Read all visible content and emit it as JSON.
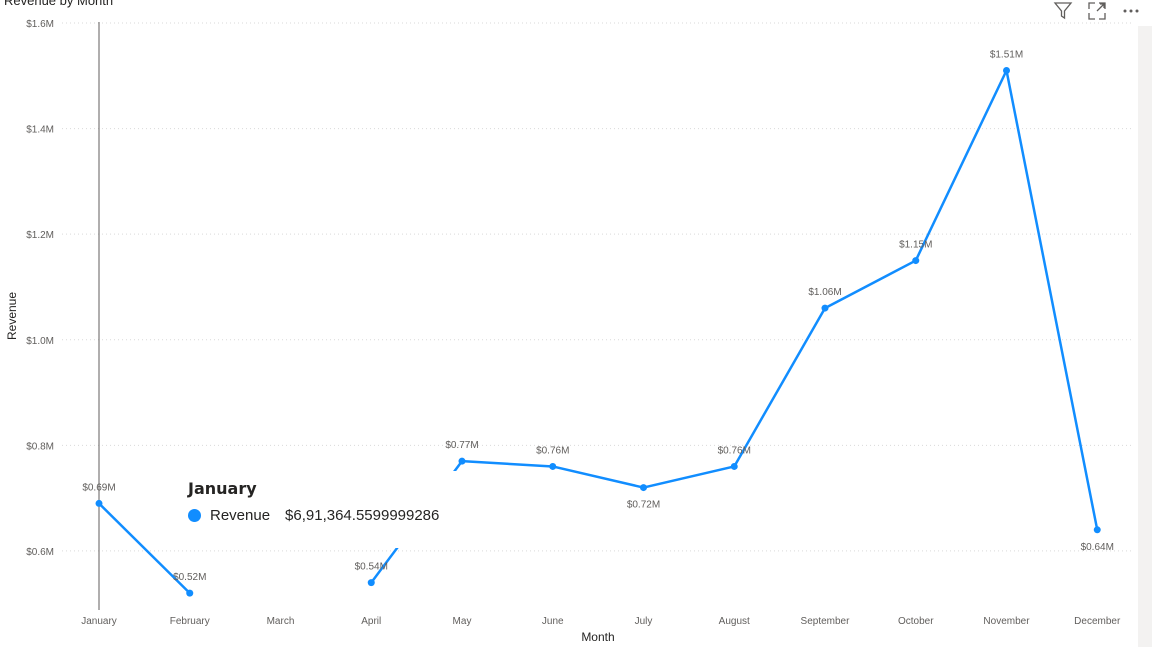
{
  "visual": {
    "title": "Revenue by Month",
    "icons": [
      {
        "name": "filter-icon"
      },
      {
        "name": "focus-mode-icon"
      },
      {
        "name": "more-options-icon"
      }
    ]
  },
  "tooltip": {
    "title": "January",
    "series_name": "Revenue",
    "value": "$6,91,364.5599999286"
  },
  "colors": {
    "series": "#118dff",
    "grid": "#d9d9d9",
    "text": "#605e5c"
  },
  "chart_data": {
    "type": "line",
    "title": "Revenue by Month",
    "xlabel": "Month",
    "ylabel": "Revenue",
    "ylim": [
      0.49,
      1.6
    ],
    "yticks": [
      0.6,
      0.8,
      1.0,
      1.2,
      1.4,
      1.6
    ],
    "ytick_labels": [
      "$0.6M",
      "$0.8M",
      "$1.0M",
      "$1.2M",
      "$1.4M",
      "$1.6M"
    ],
    "grid": true,
    "categories": [
      "January",
      "February",
      "March",
      "April",
      "May",
      "June",
      "July",
      "August",
      "September",
      "October",
      "November",
      "December"
    ],
    "series": [
      {
        "name": "Revenue",
        "values": [
          0.69,
          0.52,
          null,
          0.54,
          0.77,
          0.76,
          0.72,
          0.76,
          1.06,
          1.15,
          1.51,
          0.64
        ],
        "labels": [
          "$0.69M",
          "$0.52M",
          "",
          "$0.54M",
          "$0.77M",
          "$0.76M",
          "$0.72M",
          "$0.76M",
          "$1.06M",
          "$1.15M",
          "$1.51M",
          "$0.64M"
        ]
      }
    ]
  }
}
